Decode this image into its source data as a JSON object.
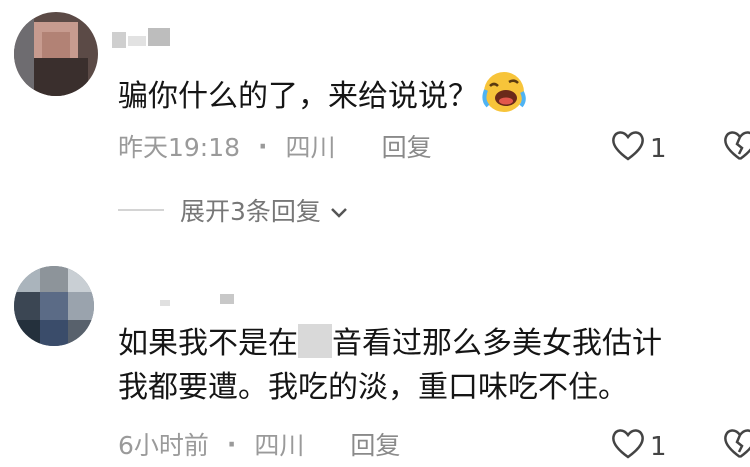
{
  "comments": [
    {
      "text": "骗你什么的了，来给说说？",
      "time": "昨天19:18",
      "location": "四川",
      "reply_label": "回复",
      "like_count": "1",
      "expand_label": "展开3条回复"
    },
    {
      "text_line1_a": "如果我不是在",
      "text_line1_b": "音看过那么多美女我估计",
      "text_line2": "我都要遭。我吃的淡，重口味吃不住。",
      "time": "6小时前",
      "location": "四川",
      "reply_label": "回复",
      "like_count": "1"
    }
  ],
  "meta_separator": "·",
  "colors": {
    "meta": "#9a9a9a",
    "text": "#151515"
  }
}
